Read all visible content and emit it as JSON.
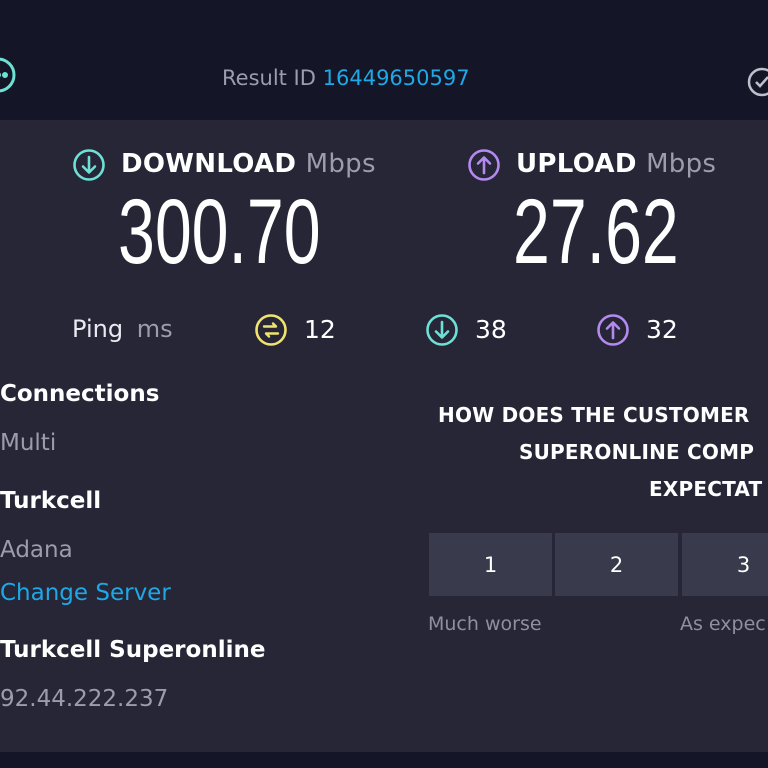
{
  "header": {
    "result_label": "Result ID",
    "result_id": "16449650597"
  },
  "download": {
    "label": "DOWNLOAD",
    "unit": "Mbps",
    "value": "300.70",
    "icon": "download-arrow-icon",
    "color": "#6ee0d6"
  },
  "upload": {
    "label": "UPLOAD",
    "unit": "Mbps",
    "value": "27.62",
    "icon": "upload-arrow-icon",
    "color": "#b48af0"
  },
  "ping": {
    "label": "Ping",
    "unit": "ms",
    "idle": "12",
    "download": "38",
    "upload": "32",
    "idle_color": "#f0e36e"
  },
  "connections": {
    "title": "Connections",
    "value": "Multi"
  },
  "server": {
    "name": "Turkcell",
    "location": "Adana",
    "change_label": "Change Server"
  },
  "isp": {
    "name": "Turkcell Superonline",
    "ip": "92.44.222.237"
  },
  "survey": {
    "line1": "HOW DOES THE CUSTOMER",
    "line2": "SUPERONLINE COMP",
    "line3": "EXPECTAT",
    "options": [
      "1",
      "2",
      "3"
    ],
    "label_low": "Much worse",
    "label_mid": "As expec"
  },
  "colors": {
    "accent_link": "#1fa8e6",
    "panel_bg": "#262637",
    "page_bg": "#141526"
  }
}
